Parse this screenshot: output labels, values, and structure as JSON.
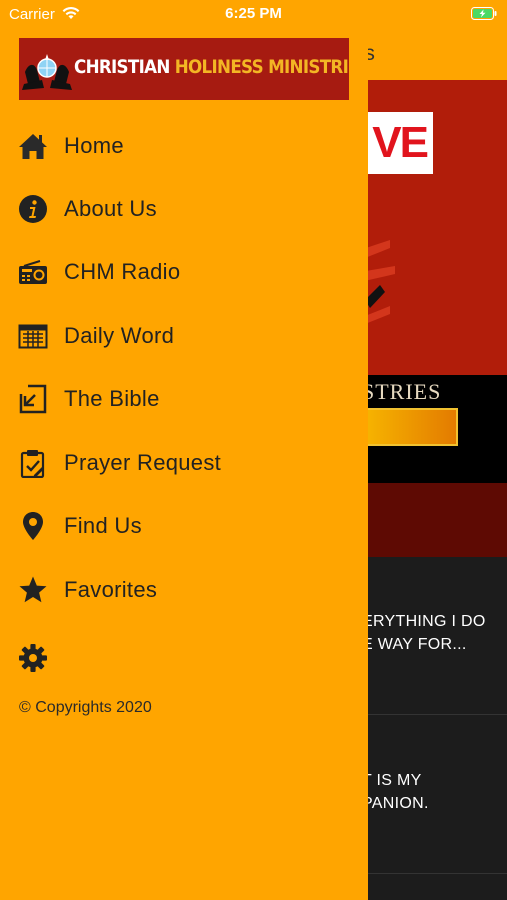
{
  "status_bar": {
    "carrier": "Carrier",
    "time": "6:25 PM"
  },
  "background": {
    "header_title_partial": "ries",
    "banner_word_partial": "VE",
    "strip_text_partial": "STRIES",
    "items": [
      {
        "text_line1": "ERYTHING I DO",
        "text_line2": "E WAY FOR..."
      },
      {
        "text_line1": "T IS MY",
        "text_line2": "PANION."
      }
    ]
  },
  "drawer": {
    "logo": {
      "word1": "CHRISTIAN",
      "word2": "HOLINESS",
      "word3": "MINISTRIES"
    },
    "menu": [
      {
        "label": "Home",
        "icon": "home-icon"
      },
      {
        "label": "About Us",
        "icon": "info-icon"
      },
      {
        "label": "CHM Radio",
        "icon": "radio-icon"
      },
      {
        "label": "Daily Word",
        "icon": "calendar-icon"
      },
      {
        "label": "The Bible",
        "icon": "book-arrow-icon"
      },
      {
        "label": "Prayer Request",
        "icon": "clipboard-icon"
      },
      {
        "label": "Find Us",
        "icon": "location-pin-icon"
      },
      {
        "label": "Favorites",
        "icon": "star-icon"
      }
    ],
    "settings_icon": "gear-icon",
    "copyright": "© Copyrights 2020"
  },
  "colors": {
    "drawer_bg": "#ffa500",
    "logo_bg": "#a61b11",
    "text_dark": "#222222",
    "banner_red": "#b11d0a"
  }
}
